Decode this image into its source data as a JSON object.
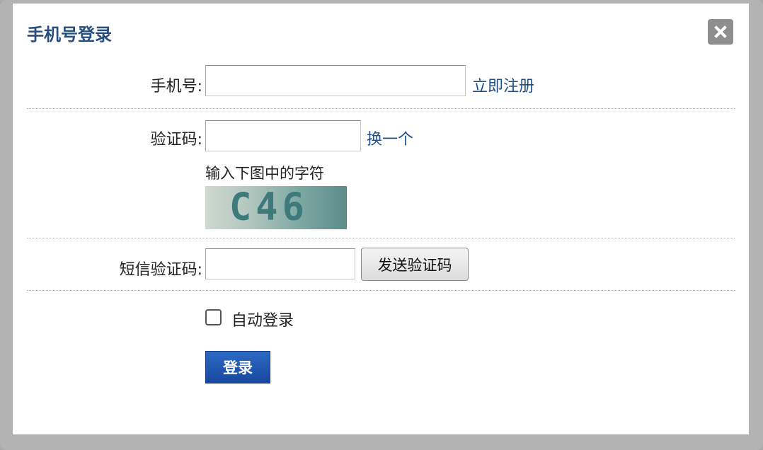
{
  "dialog": {
    "title": "手机号登录",
    "close_icon": "close-icon"
  },
  "phone": {
    "label": "手机号:",
    "value": "",
    "register_link": "立即注册"
  },
  "captcha": {
    "label": "验证码:",
    "value": "",
    "refresh_link": "换一个",
    "hint": "输入下图中的字符",
    "image_text": "C46"
  },
  "sms": {
    "label": "短信验证码:",
    "value": "",
    "send_button": "发送验证码"
  },
  "auto_login": {
    "label": "自动登录",
    "checked": false
  },
  "login_button": "登录",
  "colors": {
    "title": "#264f7f",
    "link": "#1f4f8a",
    "primary_button": "#1f56b0",
    "frame": "#b3b3b3"
  }
}
